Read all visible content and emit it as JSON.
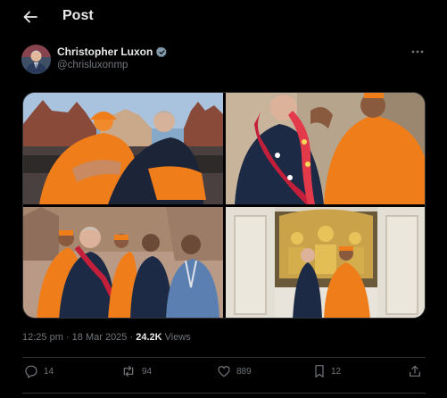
{
  "header": {
    "title": "Post",
    "back_icon": "arrow-left-icon"
  },
  "author": {
    "name": "Christopher Luxon",
    "handle": "@chrisluxonmp",
    "verified_badge": "verified-badge-icon",
    "badge_color": "#829aab"
  },
  "media": {
    "photos": [
      {
        "name": "photo-temple-embrace"
      },
      {
        "name": "photo-garland-greeting"
      },
      {
        "name": "photo-group-temple"
      },
      {
        "name": "photo-shrine-interior"
      }
    ]
  },
  "meta": {
    "time": "12:25 pm",
    "separator": " · ",
    "date": "18 Mar 2025",
    "dot": " · ",
    "views_count": "24.2K",
    "views_label": " Views"
  },
  "actions": {
    "replies": "14",
    "reposts": "94",
    "likes": "889",
    "bookmarks": "12"
  },
  "colors": {
    "background": "#000000",
    "text": "#e7e9ea",
    "muted": "#71767b",
    "border": "#2f3336"
  }
}
